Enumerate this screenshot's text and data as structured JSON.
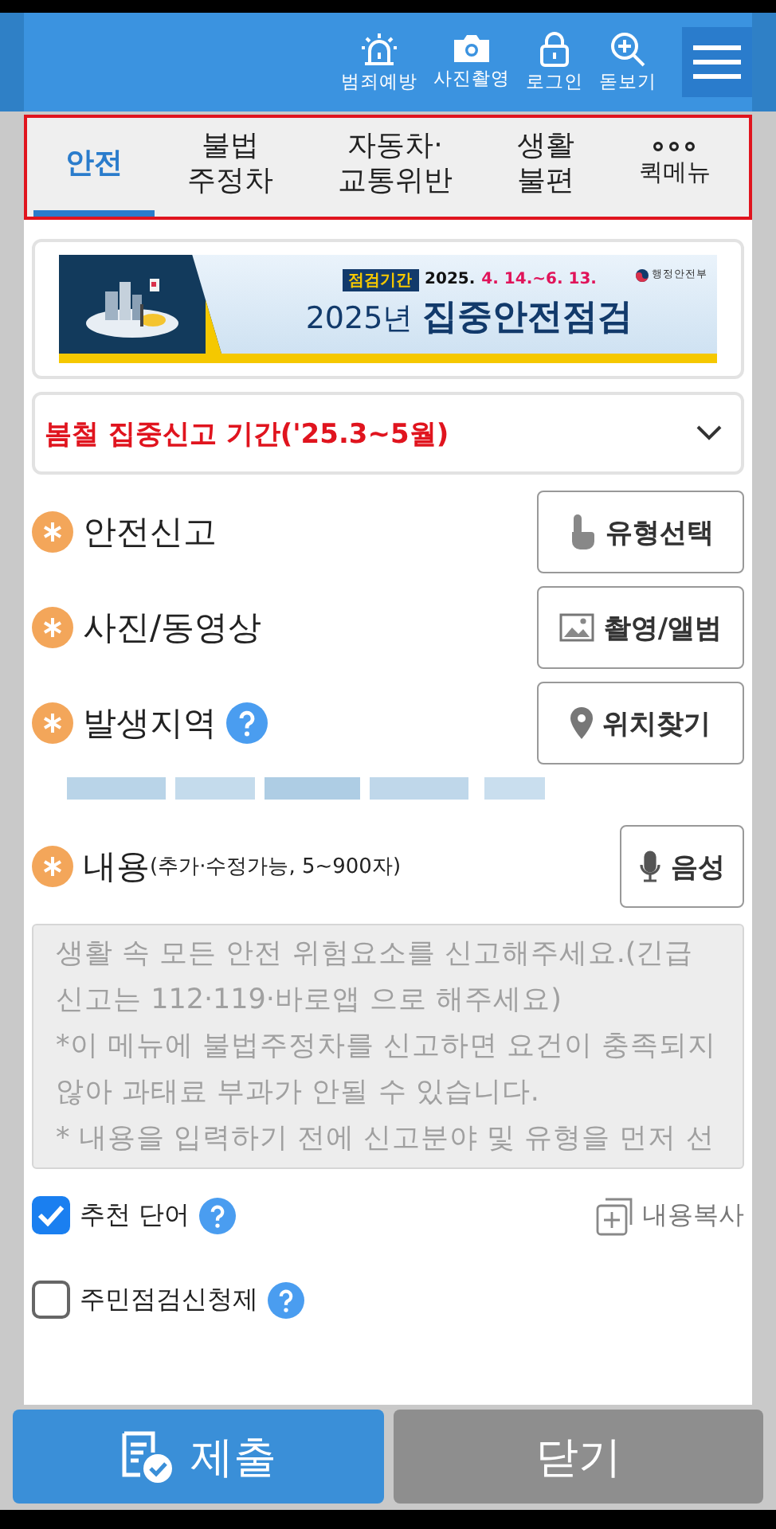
{
  "header": {
    "actions": [
      {
        "kind": "siren",
        "label": "범죄예방"
      },
      {
        "kind": "camera",
        "label": "사진촬영"
      },
      {
        "kind": "lock",
        "label": "로그인"
      },
      {
        "kind": "zoom",
        "label": "돋보기"
      }
    ]
  },
  "tabs": [
    {
      "label": "안전",
      "selected": true
    },
    {
      "label": "불법\n주정차",
      "selected": false
    },
    {
      "label": "자동차·\n교통위반",
      "selected": false
    },
    {
      "label": "생활\n불편",
      "selected": false
    },
    {
      "label": "퀵메뉴",
      "kind": "more",
      "selected": false
    }
  ],
  "banner": {
    "tag": "점검기간",
    "year": "2025.",
    "dates": "4. 14.~6. 13.",
    "ministry": "행정안전부",
    "title_prefix": "2025년",
    "title": "집중안전점검"
  },
  "notice_dropdown": {
    "value": "봄철 집중신고 기간('25.3~5월)"
  },
  "fields": [
    {
      "label": "안전신고",
      "help": false,
      "button": {
        "kind": "touch",
        "label": "유형선택"
      }
    },
    {
      "label": "사진/동영상",
      "help": false,
      "button": {
        "kind": "image",
        "label": "촬영/앨범"
      }
    },
    {
      "label": "발생지역",
      "help": true,
      "button": {
        "kind": "pin",
        "label": "위치찾기"
      }
    }
  ],
  "content": {
    "label": "내용",
    "hint": "(추가·수정가능, 5~900자)",
    "voice_button": "음성",
    "placeholder": "생활 속 모든 안전 위험요소를 신고해주세요.(긴급 신고는 112·119·바로앱 으로 해주세요)\n*이 메뉴에 불법주정차를 신고하면 요건이 충족되지 않아 과태료 부과가 안될 수 있습니다.\n* 내용을 입력하기 전에 신고분야 및 유형을 먼저 선"
  },
  "options": [
    {
      "label": "추천 단어",
      "checked": true
    },
    {
      "label": "주민점검신청제",
      "checked": false
    }
  ],
  "copy_button": "내용복사",
  "footer": {
    "submit": "제출",
    "close": "닫기"
  }
}
